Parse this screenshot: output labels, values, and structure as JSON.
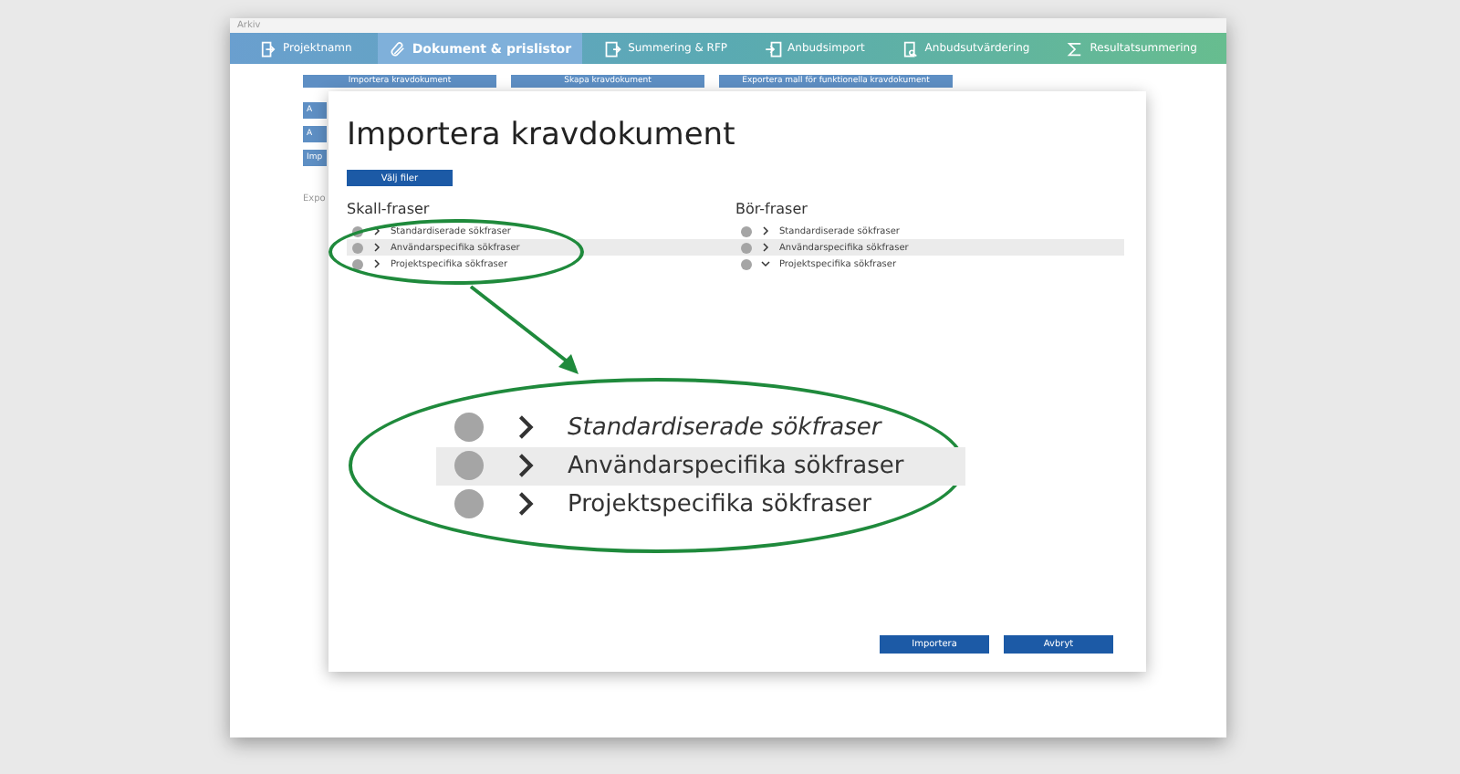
{
  "window": {
    "title": "Arkiv"
  },
  "tabs": [
    {
      "label": "Projektnamn",
      "selected": false
    },
    {
      "label": "Dokument & prislistor",
      "selected": true
    },
    {
      "label": "Summering & RFP",
      "selected": false
    },
    {
      "label": "Anbudsimport",
      "selected": false
    },
    {
      "label": "Anbudsutvärdering",
      "selected": false
    },
    {
      "label": "Resultatsummering",
      "selected": false
    }
  ],
  "toolbar": [
    "Importera kravdokument",
    "Skapa kravdokument",
    "Exportera mall för funktionella kravdokument"
  ],
  "side_buttons": [
    "A",
    "A",
    "Imp"
  ],
  "side_text": "Expo",
  "dialog": {
    "title": "Importera kravdokument",
    "choose_button": "Välj filer",
    "groups": [
      {
        "title": "Skall-fraser",
        "items": [
          {
            "label": "Standardiserade sökfraser",
            "selected": false,
            "expanded": false
          },
          {
            "label": "Användarspecifika sökfraser",
            "selected": true,
            "expanded": false
          },
          {
            "label": "Projektspecifika sökfraser",
            "selected": false,
            "expanded": false
          }
        ]
      },
      {
        "title": "Bör-fraser",
        "items": [
          {
            "label": "Standardiserade sökfraser",
            "selected": false,
            "expanded": false
          },
          {
            "label": "Användarspecifika sökfraser",
            "selected": true,
            "expanded": false
          },
          {
            "label": "Projektspecifika sökfraser",
            "selected": false,
            "expanded": true
          }
        ]
      }
    ],
    "buttons": [
      "Importera",
      "Avbryt"
    ]
  },
  "callout": {
    "items": [
      {
        "label": "Standardiserade sökfraser",
        "selected": false
      },
      {
        "label": "Användarspecifika sökfraser",
        "selected": true
      },
      {
        "label": "Projektspecifika sökfraser",
        "selected": false
      }
    ]
  }
}
